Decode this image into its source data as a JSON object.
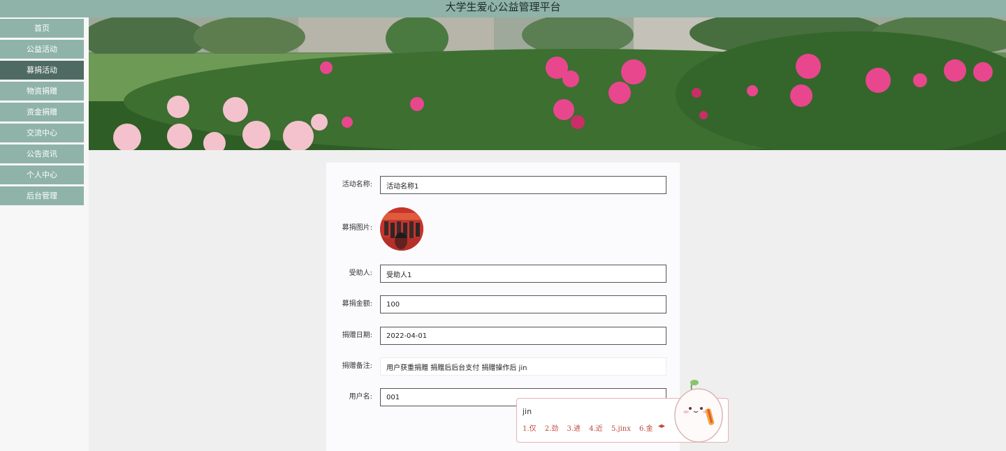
{
  "app": {
    "title": "大学生爱心公益管理平台"
  },
  "sidebar": {
    "items": [
      {
        "label": "首页",
        "active": false
      },
      {
        "label": "公益活动",
        "active": false
      },
      {
        "label": "募捐活动",
        "active": true
      },
      {
        "label": "物资捐赠",
        "active": false
      },
      {
        "label": "资金捐赠",
        "active": false
      },
      {
        "label": "交流中心",
        "active": false
      },
      {
        "label": "公告资讯",
        "active": false
      },
      {
        "label": "个人中心",
        "active": false
      },
      {
        "label": "后台管理",
        "active": false
      }
    ]
  },
  "form": {
    "activity_name": {
      "label": "活动名称:",
      "value": "活动名称1"
    },
    "image": {
      "label": "募捐图片:"
    },
    "beneficiary": {
      "label": "受助人:",
      "value": "受助人1"
    },
    "amount": {
      "label": "募捐金额:",
      "value": "100"
    },
    "date": {
      "label": "捐赠日期:",
      "value": "2022-04-01"
    },
    "remark": {
      "label": "捐赠备注:",
      "value": "用户获重捐赠 捐赠后后台支付 捐赠操作后 jin"
    },
    "username": {
      "label": "用户名:",
      "value": "001"
    }
  },
  "ime": {
    "input": "jin",
    "candidates": [
      "1.仅",
      "2.劲",
      "3.进",
      "4.近",
      "5.jinx",
      "6.金"
    ],
    "arrows": "◂▸"
  },
  "colors": {
    "primary": "#8fb3a8",
    "active": "#4f6a62",
    "background": "#efefef"
  }
}
